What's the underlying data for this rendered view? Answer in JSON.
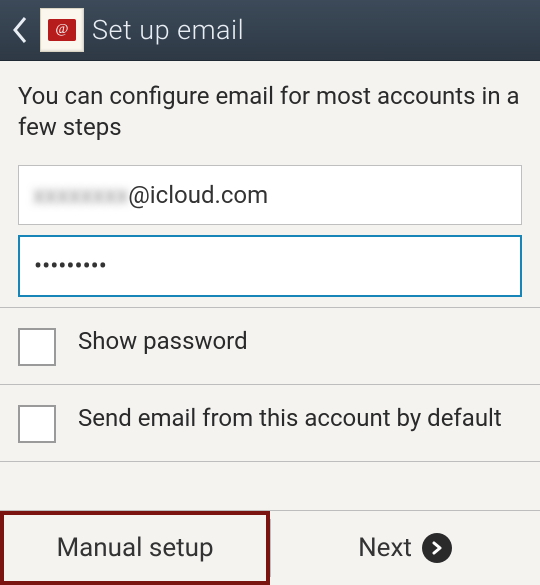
{
  "header": {
    "title": "Set up email",
    "app_icon_symbol": "@"
  },
  "intro": "You can configure email for most accounts in a few steps",
  "fields": {
    "email": {
      "redacted_part": "xxxxxxxx",
      "domain_part": "@icloud.com"
    },
    "password": {
      "masked": "•••••••••"
    }
  },
  "options": {
    "show_password": "Show password",
    "default_account": "Send email from this account by default"
  },
  "buttons": {
    "manual": "Manual setup",
    "next": "Next"
  }
}
